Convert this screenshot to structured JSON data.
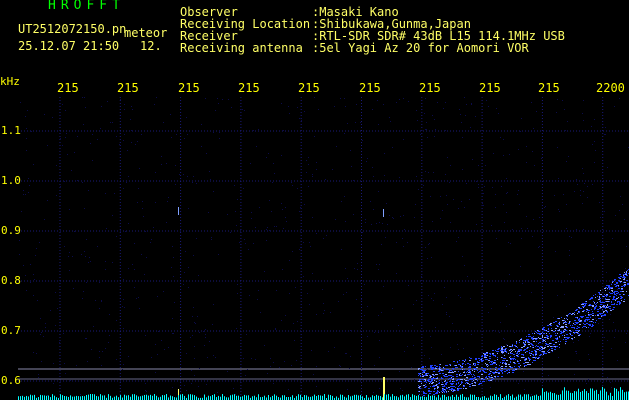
{
  "header": {
    "logo": "HROFFT",
    "filename": "UT2512072150.pn",
    "mode": "meteor",
    "datetime": "25.12.07 21:50",
    "count": "12."
  },
  "info": [
    {
      "label": "Observer",
      "value": ":Masaki Kano"
    },
    {
      "label": "Receiving Location",
      "value": ":Shibukawa,Gunma,Japan"
    },
    {
      "label": "Receiver",
      "value": ":RTL-SDR SDR# 43dB L15 114.1MHz USB"
    },
    {
      "label": "Receiving antenna",
      "value": ":5el Yagi Az 20 for Aomori VOR"
    }
  ],
  "axis": {
    "unit": "kHz",
    "time_ticks": [
      "215",
      "215",
      "215",
      "215",
      "215",
      "215",
      "215",
      "215",
      "215",
      "2200"
    ],
    "freq_ticks": [
      "1.1",
      "1.0",
      "0.9",
      "0.8",
      "0.7",
      "0.6"
    ]
  },
  "colors": {
    "logo": "#00ff00",
    "text": "#ffff66",
    "axis_text": "#ffff00",
    "grid": "#1a1a78",
    "signal": "#2040ff",
    "baseline": "#00ffff"
  }
}
